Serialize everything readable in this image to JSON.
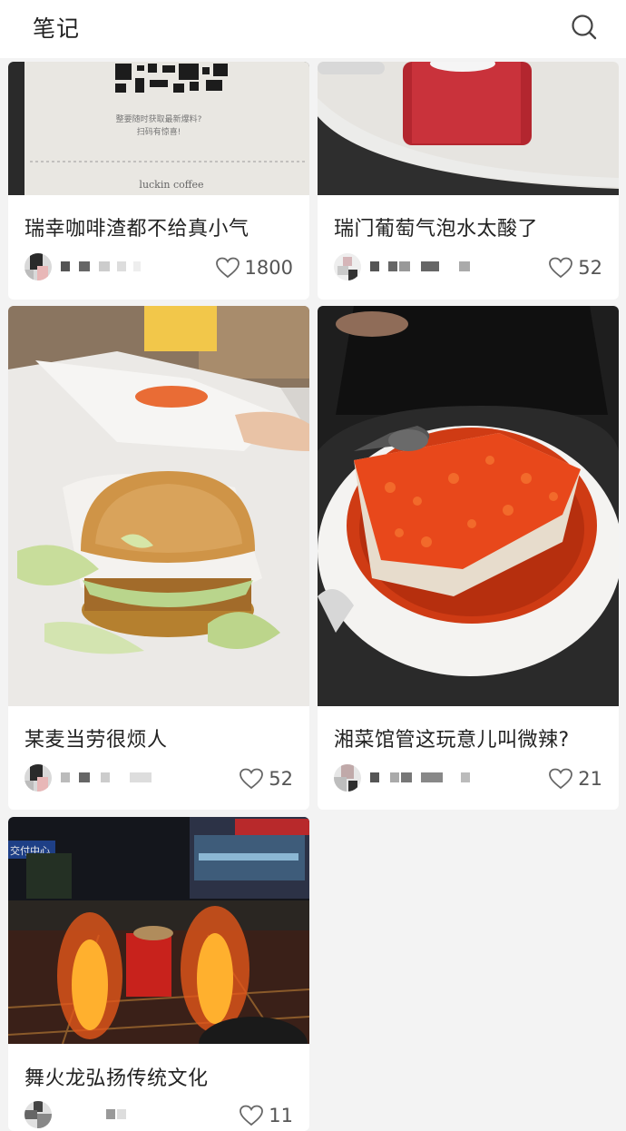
{
  "header": {
    "title": "笔记",
    "search_icon": "search-icon"
  },
  "colors": {
    "background": "#f3f3f3",
    "card": "#ffffff",
    "text": "#222222",
    "muted": "#555555"
  },
  "posts": [
    {
      "caption": "瑞幸咖啡渣都不给真小气",
      "likes": "1800",
      "image": "coffee-receipt-photo"
    },
    {
      "caption": "瑞门葡萄气泡水太酸了",
      "likes": "52",
      "image": "red-drink-cup-photo"
    },
    {
      "caption": "某麦当劳很烦人",
      "likes": "52",
      "image": "burger-photo"
    },
    {
      "caption": "湘菜馆管这玩意儿叫微辣?",
      "likes": "21",
      "image": "chili-fish-plate-photo"
    },
    {
      "caption": "舞火龙弘扬传统文化",
      "likes": "11",
      "image": "fire-dragon-night-photo"
    }
  ],
  "receipt_text": {
    "line1": "整要随时获取最新爆料?",
    "line2": "扫码有惊喜!",
    "brand": "luckin coffee"
  },
  "plaza_sign": "交付中心"
}
